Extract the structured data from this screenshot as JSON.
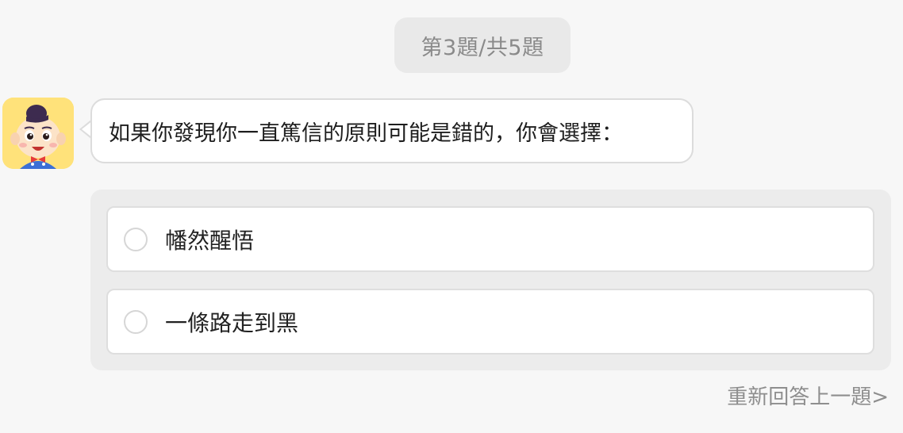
{
  "progress": {
    "label": "第3題/共5題"
  },
  "question": {
    "text": "如果你發現你一直篤信的原則可能是錯的，你會選擇："
  },
  "options": [
    {
      "label": "幡然醒悟",
      "selected": false
    },
    {
      "label": "一條路走到黑",
      "selected": false
    }
  ],
  "footer": {
    "redo_label": "重新回答上一題>"
  },
  "colors": {
    "background": "#f7f7f7",
    "pill": "#e9e9e9",
    "panel": "#ececec",
    "avatar_bg": "#ffe27a"
  }
}
